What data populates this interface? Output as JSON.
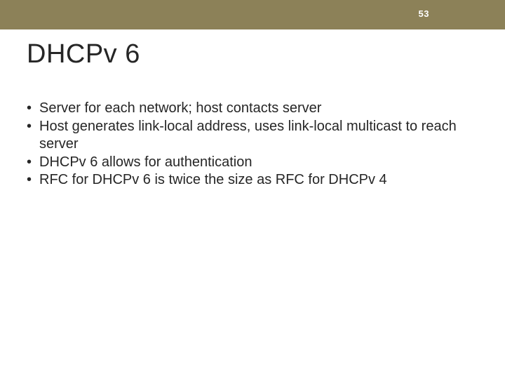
{
  "header": {
    "page_number": "53"
  },
  "title": "DHCPv 6",
  "bullets": [
    "Server for each network; host contacts server",
    "Host generates link-local address, uses link-local multicast to reach server",
    "DHCPv 6 allows for authentication",
    "RFC for DHCPv 6 is twice the size as RFC for DHCPv 4"
  ]
}
